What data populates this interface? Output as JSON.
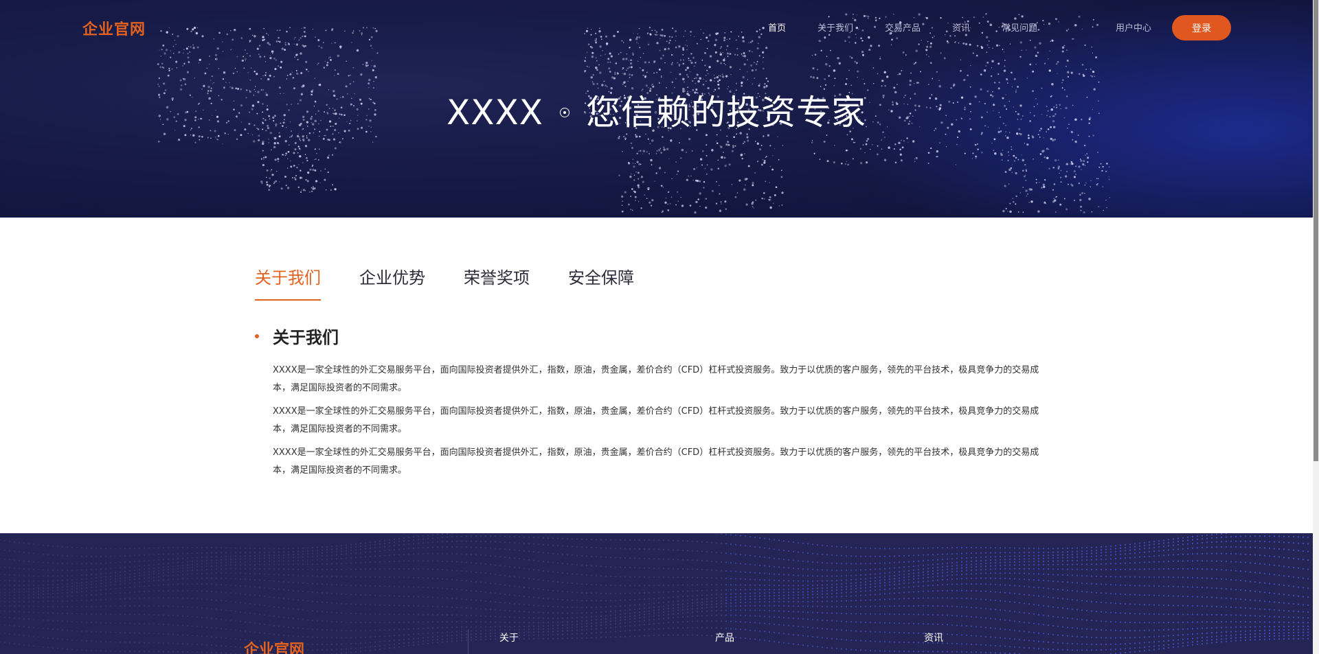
{
  "header": {
    "brand": "企业官网",
    "nav": [
      {
        "label": "首页",
        "active": true
      },
      {
        "label": "关于我们",
        "active": false
      },
      {
        "label": "交易产品",
        "active": false
      },
      {
        "label": "资讯",
        "active": false
      },
      {
        "label": "常见问题",
        "active": false
      }
    ],
    "user_center": "用户中心",
    "login": "登录"
  },
  "hero": {
    "title_left": "XXXX",
    "title_right": "您信赖的投资专家"
  },
  "main": {
    "tabs": [
      {
        "label": "关于我们",
        "active": true
      },
      {
        "label": "企业优势",
        "active": false
      },
      {
        "label": "荣誉奖项",
        "active": false
      },
      {
        "label": "安全保障",
        "active": false
      }
    ],
    "section_title": "关于我们",
    "paragraphs": [
      "XXXX是一家全球性的外汇交易服务平台，面向国际投资者提供外汇，指数，原油，贵金属，差价合约（CFD）杠杆式投资服务。致力于以优质的客户服务，领先的平台技术，极具竞争力的交易成本，满足国际投资者的不同需求。",
      "XXXX是一家全球性的外汇交易服务平台，面向国际投资者提供外汇，指数，原油，贵金属，差价合约（CFD）杠杆式投资服务。致力于以优质的客户服务，领先的平台技术，极具竞争力的交易成本，满足国际投资者的不同需求。",
      "XXXX是一家全球性的外汇交易服务平台，面向国际投资者提供外汇，指数，原油，贵金属，差价合约（CFD）杠杆式投资服务。致力于以优质的客户服务，领先的平台技术，极具竞争力的交易成本，满足国际投资者的不同需求。"
    ]
  },
  "footer": {
    "brand": "企业官网",
    "columns": [
      "关于",
      "产品",
      "资讯"
    ]
  },
  "colors": {
    "accent": "#e2611f",
    "hero_bg": "#161a45",
    "footer_bg": "#252555"
  }
}
